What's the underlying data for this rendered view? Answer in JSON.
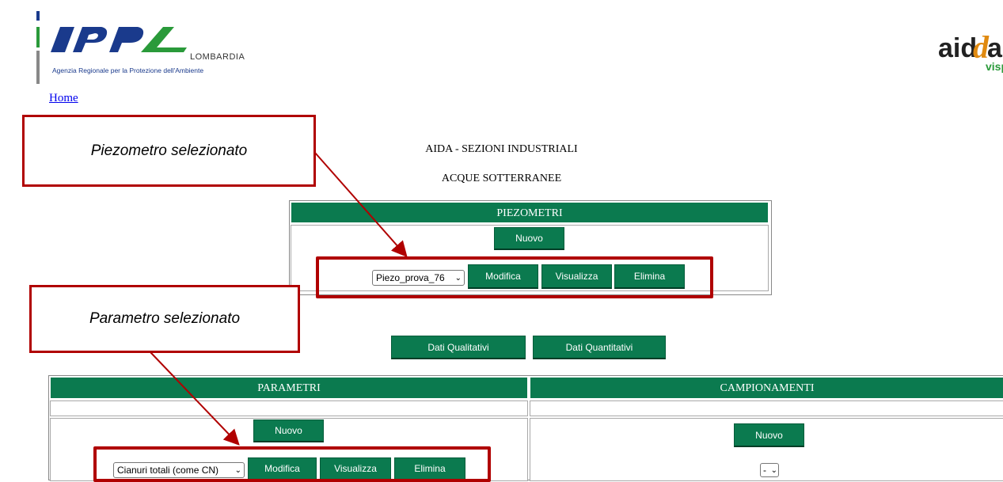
{
  "header": {
    "arpa_logo": {
      "brand": "ARPA",
      "region": "LOMBARDIA",
      "subtitle": "Agenzia Regionale per la Protezione dell'Ambiente"
    },
    "aida_logo": {
      "text_main": "aid",
      "text_accent": "a",
      "text_sub": "visp"
    },
    "home_link": "Home"
  },
  "page": {
    "title": "AIDA - SEZIONI INDUSTRIALI",
    "subtitle": "ACQUE SOTTERRANEE"
  },
  "piezometri": {
    "header": "PIEZOMETRI",
    "new_label": "Nuovo",
    "selected": "Piezo_prova_76",
    "modify_label": "Modifica",
    "view_label": "Visualizza",
    "delete_label": "Elimina"
  },
  "data_buttons": {
    "qualitative": "Dati Qualitativi",
    "quantitative": "Dati Quantitativi"
  },
  "parametri": {
    "header": "PARAMETRI",
    "new_label": "Nuovo",
    "selected": "Cianuri totali (come CN)",
    "modify_label": "Modifica",
    "view_label": "Visualizza",
    "delete_label": "Elimina"
  },
  "campionamenti": {
    "header": "CAMPIONAMENTI",
    "new_label": "Nuovo",
    "selected": "-"
  },
  "annotations": {
    "callout_piezometro": "Piezometro selezionato",
    "callout_parametro": "Parametro selezionato"
  },
  "colors": {
    "header_green": "#0b7a4f",
    "annotation_red": "#b00000",
    "link_blue": "#0000ee"
  }
}
